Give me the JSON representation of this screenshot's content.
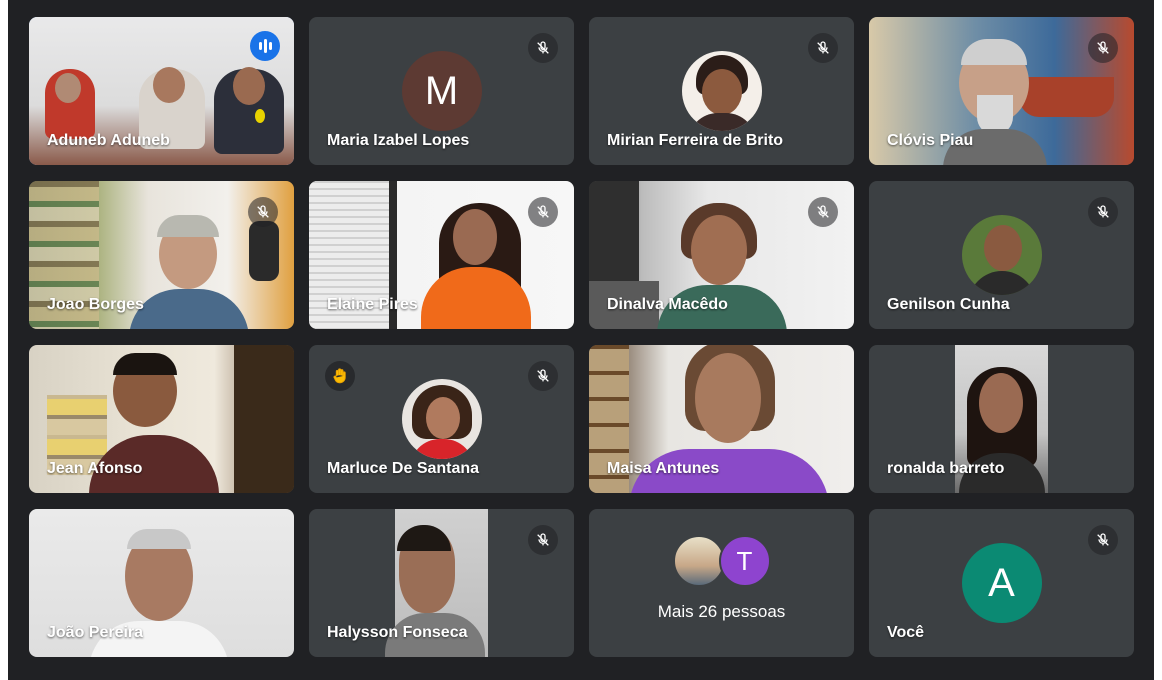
{
  "icons": {
    "muted": "mic-off-icon",
    "speaking": "audio-level-icon",
    "hand": "raised-hand-icon"
  },
  "colors": {
    "background": "#202124",
    "tile": "#3c4043",
    "active_border": "#8ab4f8",
    "speaking": "#1a73e8"
  },
  "participants": [
    {
      "name": "Aduneb Aduneb"
    },
    {
      "name": "Maria Izabel Lopes",
      "avatar_letter": "M"
    },
    {
      "name": "Mirian Ferreira de Brito"
    },
    {
      "name": "Clóvis Piau"
    },
    {
      "name": "Joao Borges"
    },
    {
      "name": "Elaine Pires"
    },
    {
      "name": "Dinalva Macêdo"
    },
    {
      "name": "Genilson Cunha"
    },
    {
      "name": "Jean Afonso"
    },
    {
      "name": "Marluce De Santana"
    },
    {
      "name": "Maisa Antunes"
    },
    {
      "name": "ronalda barreto"
    },
    {
      "name": "João Pereira"
    },
    {
      "name": "Halysson Fonseca"
    },
    {
      "more_text": "Mais 26 pessoas",
      "avatar_letter": "T"
    },
    {
      "name": "Você",
      "avatar_letter": "A"
    }
  ]
}
